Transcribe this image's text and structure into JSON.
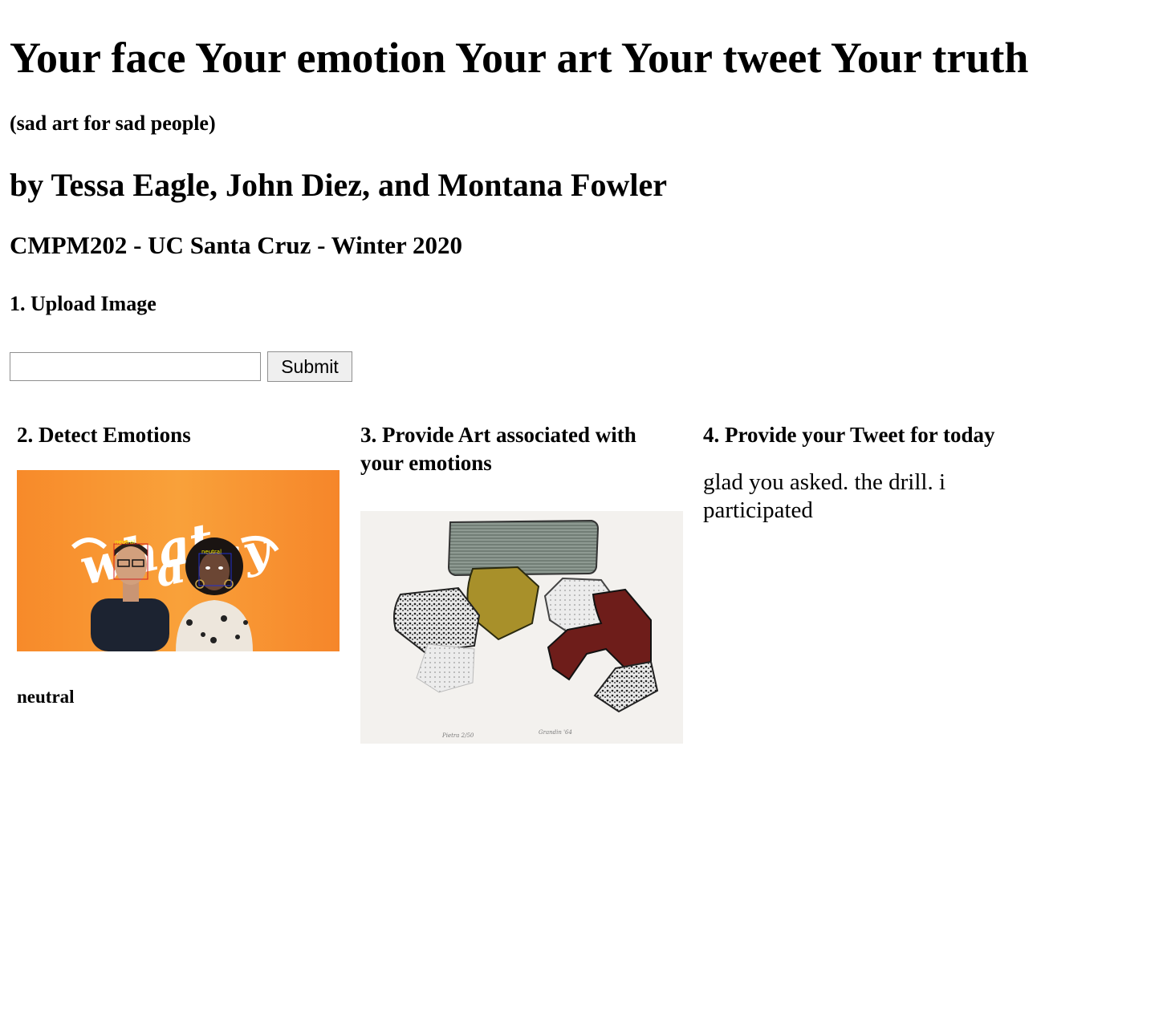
{
  "header": {
    "title": "Your face Your emotion Your art Your tweet Your truth",
    "subtitle": "(sad art for sad people)",
    "authors": "by Tessa Eagle, John Diez, and Montana Fowler",
    "course": "CMPM202 - UC Santa Cruz - Winter 2020"
  },
  "upload": {
    "heading": "1. Upload Image",
    "input_value": "",
    "input_placeholder": "",
    "submit_label": "Submit"
  },
  "detect": {
    "heading": "2. Detect Emotions",
    "photo_text": "what a day",
    "face_labels": [
      "neutral",
      "neutral"
    ],
    "emotion": "neutral"
  },
  "art": {
    "heading": "3. Provide Art associated with your emotions"
  },
  "tweet": {
    "heading": "4. Provide your Tweet for today",
    "text": "glad you asked. the drill. i participated"
  }
}
